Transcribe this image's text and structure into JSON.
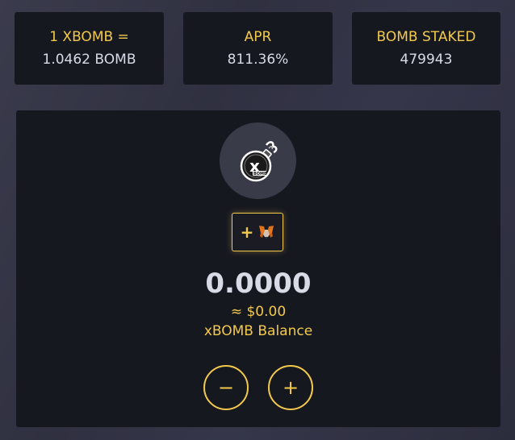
{
  "stats": {
    "ratio": {
      "label": "1 XBOMB =",
      "value": "1.0462 BOMB"
    },
    "apr": {
      "label": "APR",
      "value": "811.36%"
    },
    "staked": {
      "label": "BOMB STAKED",
      "value": "479943"
    }
  },
  "card": {
    "token_icon": "xbomb-token-icon",
    "wallet_button": {
      "plus": "+",
      "icon": "metamask-fox-icon"
    },
    "balance": "0.0000",
    "usd": "≈ $0.00",
    "balance_label": "xBOMB Balance",
    "minus_label": "−",
    "plus_label": "+"
  },
  "colors": {
    "accent": "#f3c94c",
    "panel": "#161820",
    "text": "#d6dbe6"
  }
}
